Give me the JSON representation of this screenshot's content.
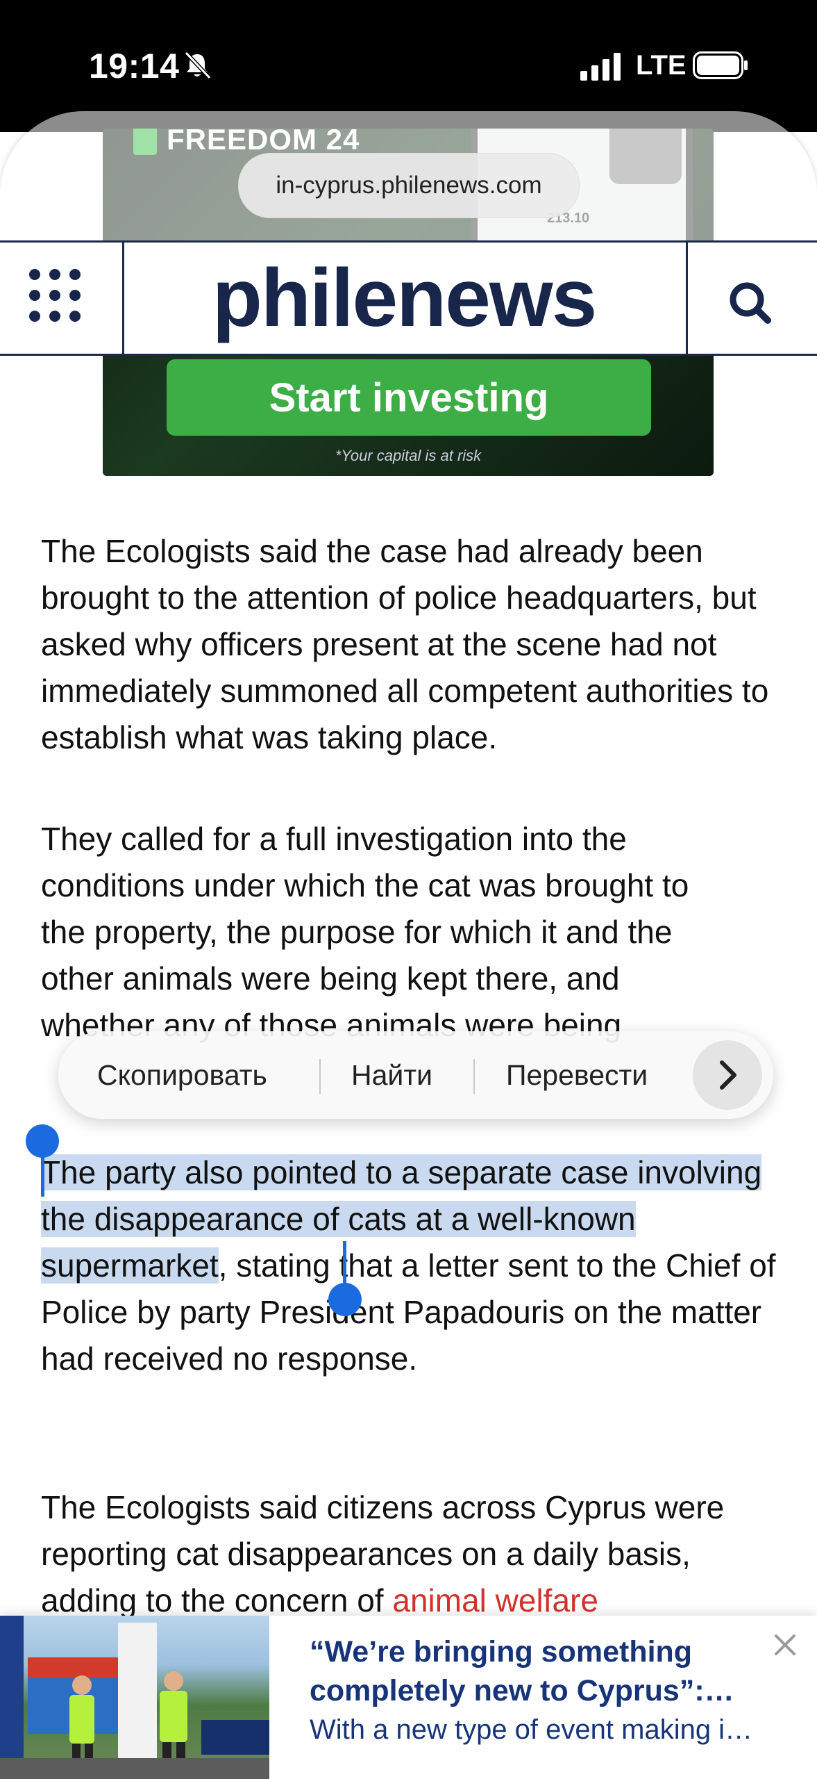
{
  "status_bar": {
    "time": "19:14",
    "network": "LTE"
  },
  "browser": {
    "url": "in-cyprus.philenews.com"
  },
  "ad_top": {
    "brand": "FREEDOM 24",
    "cta": "Start investing",
    "disclaimer": "*Your capital is at risk",
    "phone_value": "213.10"
  },
  "site": {
    "brand": "philenews"
  },
  "article": {
    "p1": "The Ecologists said the case had already been brought to the attention of police headquarters, but asked why officers present at the scene had not immediately summoned all competent authorities to establish what was taking place.",
    "p2_line1": "They called for a full investigation into the",
    "p2_line2": "conditions under which the cat was brought to",
    "p2_line3": "the property, the purpose for which it and the",
    "p2_line4": "other animals were being kept there, and",
    "p2_line5": "whether any of those animals were being",
    "p3_selected": "The party also pointed to a separate case involving the disappearance of cats at a well-known supermarket",
    "p3_rest": ", stating that a letter sent to the Chief of Police by party President Papadouris on the matter had received no response.",
    "p4_text": "The Ecologists said citizens across Cyprus were reporting cat disappearances on a daily basis, adding to the concern of ",
    "p4_link": "animal welfare"
  },
  "context_menu": {
    "copy": "Скопировать",
    "find": "Найти",
    "translate": "Перевести"
  },
  "bottom_ad": {
    "title": "“We’re bringing something completely new to Cyprus”:…",
    "subtitle": "With a new type of event making i…"
  },
  "colors": {
    "brand_navy": "#17264a",
    "selection": "#c9daf0",
    "handle": "#1a6ae0",
    "link": "#d2332c",
    "ad_green": "#3cae45"
  }
}
